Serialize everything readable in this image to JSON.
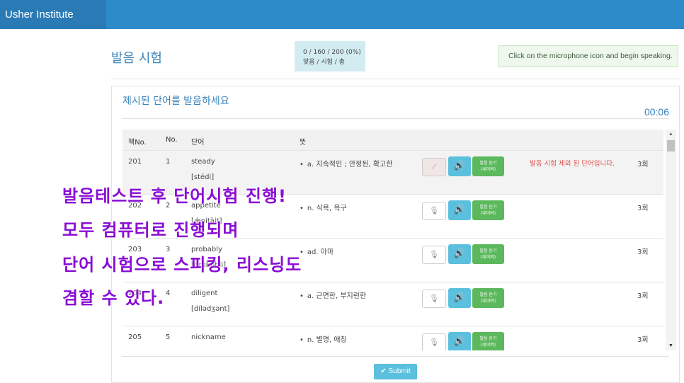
{
  "app": {
    "brand": "Usher Institute"
  },
  "header": {
    "title": "발음 시험",
    "progress_line1": "0 / 160 / 200 (0%)",
    "progress_line2": "맞음 / 시험 / 총",
    "notice": "Click on the microphone icon and begin speaking."
  },
  "panel": {
    "title": "제시된 단어를 발음하세요",
    "timer": "00:06"
  },
  "table": {
    "headers": [
      "책No.",
      "No.",
      "단어",
      "뜻"
    ],
    "listen_label_1": "발음 듣기",
    "listen_label_2": "(네이버)",
    "rows": [
      {
        "book_no": "201",
        "no": "1",
        "word": "steady",
        "pron": "[stédi]",
        "meaning": "a. 지속적인 ; 안정된, 확고한",
        "status": "발음 시험 제외 된 단어입니다.",
        "times": "3회"
      },
      {
        "book_no": "202",
        "no": "2",
        "word": "appetite",
        "pron": "[ǽpitàit]",
        "meaning": "n. 식욕, 욕구",
        "status": "",
        "times": "3회"
      },
      {
        "book_no": "203",
        "no": "3",
        "word": "probably",
        "pron": "[prɑ́bəbli]",
        "meaning": "ad. 아마",
        "status": "",
        "times": "3회"
      },
      {
        "book_no": "204",
        "no": "4",
        "word": "diligent",
        "pron": "[dílədʒənt]",
        "meaning": "a. 근면한, 부지런한",
        "status": "",
        "times": "3회"
      },
      {
        "book_no": "205",
        "no": "5",
        "word": "nickname",
        "pron": "",
        "meaning": "n. 별명, 애칭",
        "status": "",
        "times": "3회"
      }
    ]
  },
  "submit_label": "Submit",
  "overlay": {
    "line1": "발음테스트 후 단어시험 진행!",
    "line2": "모두 컴퓨터로 진행되며",
    "line3": "단어 시험으로 스피킹, 리스닝도",
    "line4": "겸할 수 있다."
  },
  "icons": {
    "mic": "microphone-icon",
    "speaker": "speaker-icon",
    "check": "check-icon"
  },
  "colors": {
    "topbar": "#2d8bc9",
    "accent": "#3a82b8",
    "overlay": "#8a0cd4",
    "listen": "#5cb85c",
    "speaker": "#5bc0de"
  }
}
